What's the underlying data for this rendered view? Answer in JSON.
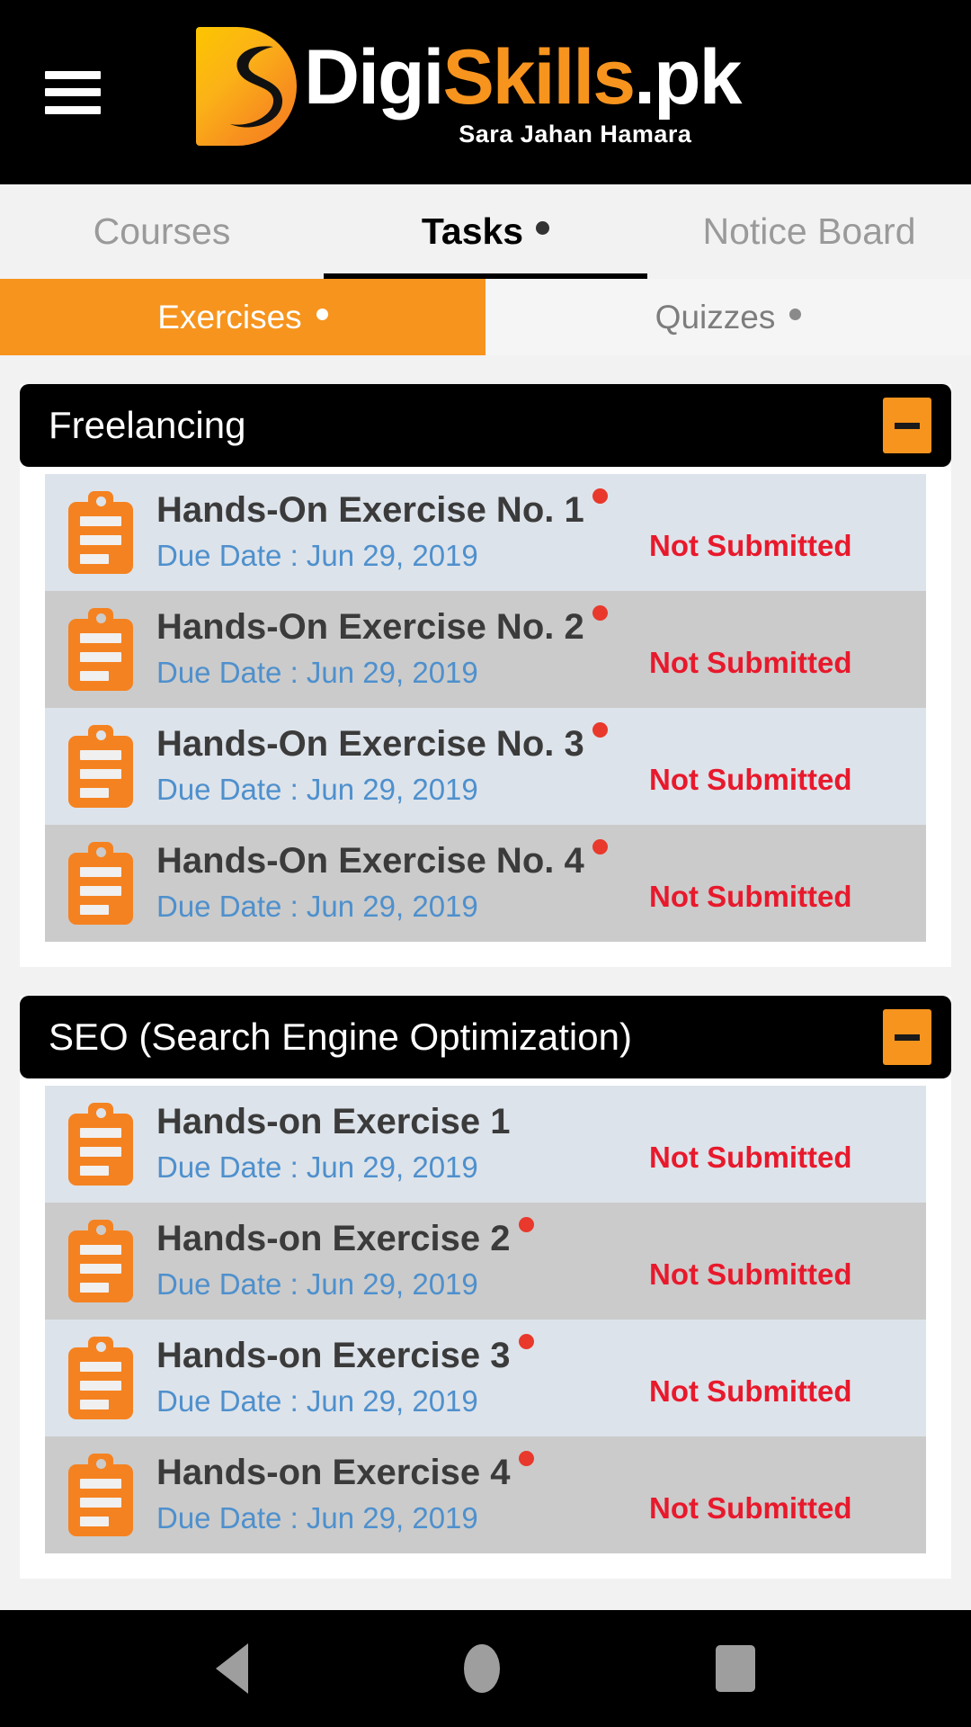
{
  "app": {
    "menu_icon": "hamburger-menu-icon",
    "logo": {
      "part1": "Digi",
      "part2": "Skills",
      "part3": ".pk",
      "tagline": "Sara Jahan Hamara"
    }
  },
  "tabs_main": [
    {
      "label": "Courses",
      "active": false,
      "has_dot": false
    },
    {
      "label": "Tasks",
      "active": true,
      "has_dot": true
    },
    {
      "label": "Notice Board",
      "active": false,
      "has_dot": false
    }
  ],
  "tabs_sub": [
    {
      "label": "Exercises",
      "active": true,
      "has_dot": true
    },
    {
      "label": "Quizzes",
      "active": false,
      "has_dot": true
    }
  ],
  "colors": {
    "accent_orange": "#f7941e",
    "header_black": "#000000",
    "status_red": "#e8192c",
    "due_date_blue": "#4e90cd",
    "row_odd": "#dde3ea",
    "row_even": "#cbcbcb"
  },
  "sections": [
    {
      "title": "Freelancing",
      "collapse_label": "−",
      "rows": [
        {
          "title": "Hands-On Exercise No. 1",
          "due": "Due Date : Jun 29, 2019",
          "status": "Not Submitted",
          "has_dot": true
        },
        {
          "title": "Hands-On Exercise No. 2",
          "due": "Due Date : Jun 29, 2019",
          "status": "Not Submitted",
          "has_dot": true
        },
        {
          "title": "Hands-On Exercise No. 3",
          "due": "Due Date : Jun 29, 2019",
          "status": "Not Submitted",
          "has_dot": true
        },
        {
          "title": "Hands-On Exercise No. 4",
          "due": "Due Date : Jun 29, 2019",
          "status": "Not Submitted",
          "has_dot": true
        }
      ]
    },
    {
      "title": "SEO (Search Engine Optimization)",
      "collapse_label": "−",
      "rows": [
        {
          "title": "Hands-on Exercise 1",
          "due": "Due Date : Jun 29, 2019",
          "status": "Not Submitted",
          "has_dot": false
        },
        {
          "title": "Hands-on Exercise 2",
          "due": "Due Date : Jun 29, 2019",
          "status": "Not Submitted",
          "has_dot": true
        },
        {
          "title": "Hands-on Exercise 3",
          "due": "Due Date : Jun 29, 2019",
          "status": "Not Submitted",
          "has_dot": true
        },
        {
          "title": "Hands-on Exercise 4",
          "due": "Due Date : Jun 29, 2019",
          "status": "Not Submitted",
          "has_dot": true
        }
      ]
    }
  ],
  "navbar": {
    "back": "back-triangle-icon",
    "home": "home-circle-icon",
    "recents": "recents-square-icon"
  }
}
